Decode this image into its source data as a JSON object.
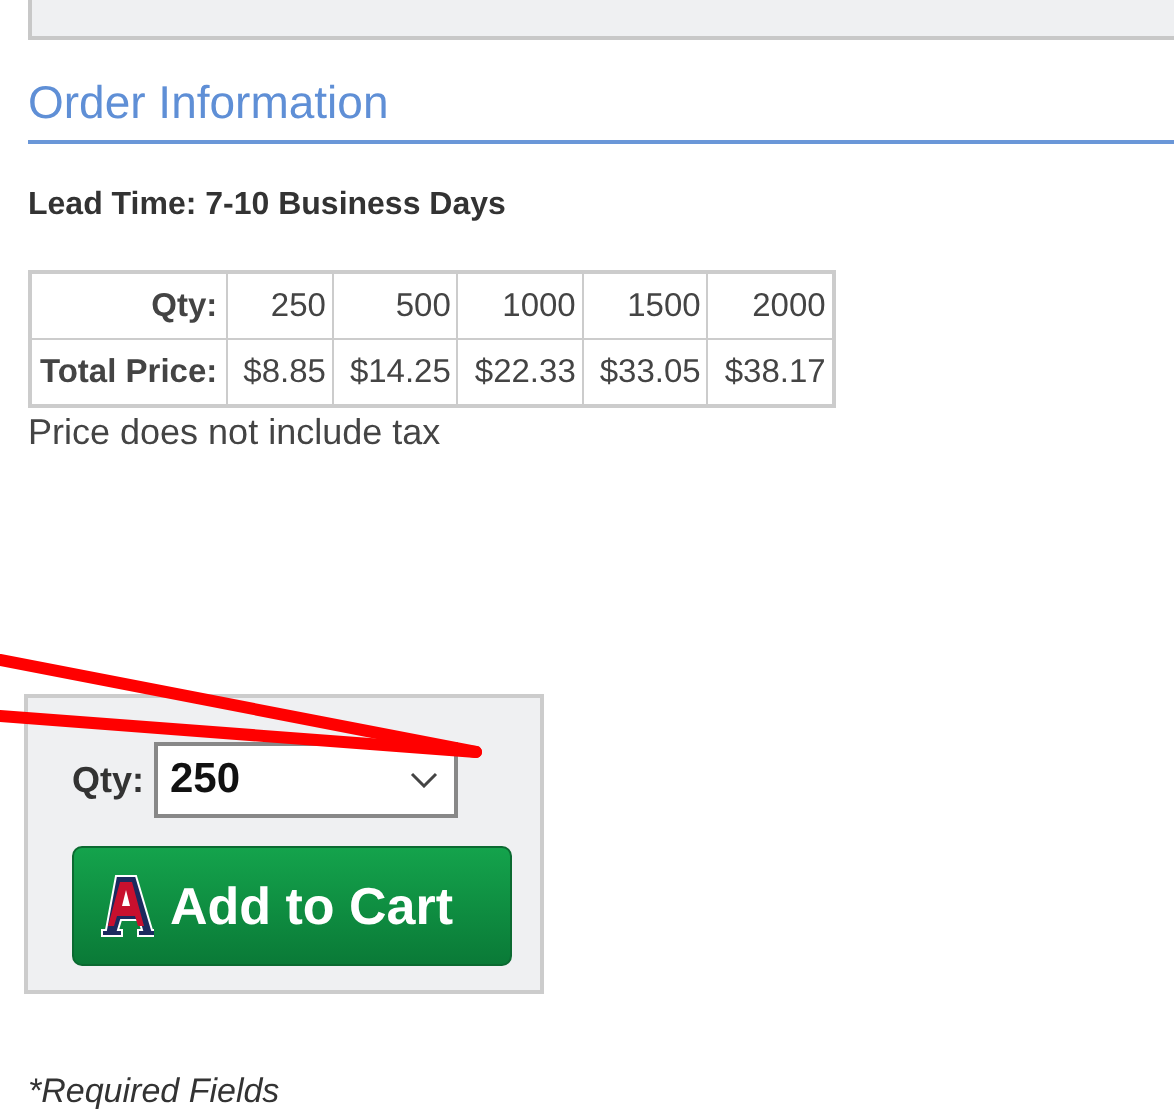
{
  "section": {
    "title": "Order Information"
  },
  "lead_time": "Lead Time: 7-10 Business Days",
  "price_table": {
    "rows": [
      {
        "header": "Qty:",
        "cells": [
          "250",
          "500",
          "1000",
          "1500",
          "2000"
        ]
      },
      {
        "header": "Total Price:",
        "cells": [
          "$8.85",
          "$14.25",
          "$22.33",
          "$33.05",
          "$38.17"
        ]
      }
    ]
  },
  "tax_note": "Price does not include tax",
  "order_box": {
    "qty_label": "Qty:",
    "qty_value": "250",
    "button": "Add to Cart"
  },
  "required_note": "*Required Fields"
}
